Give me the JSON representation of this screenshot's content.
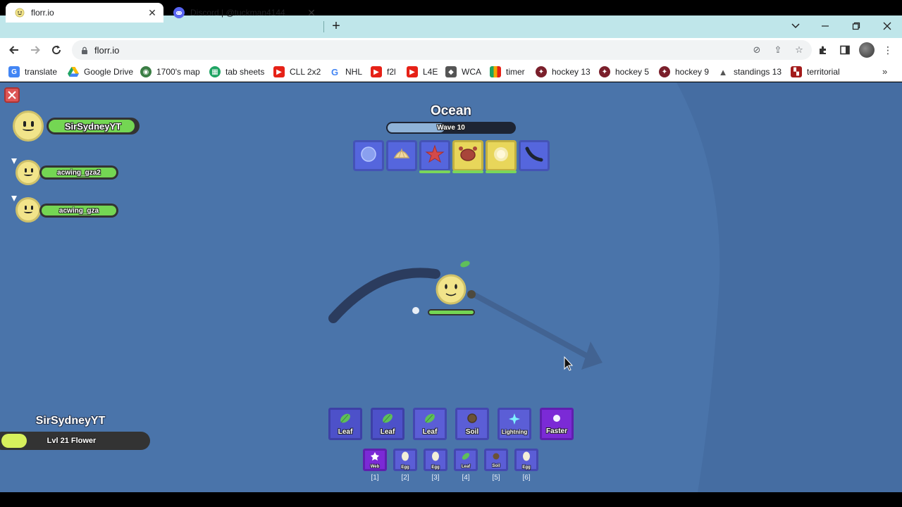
{
  "browser": {
    "tabs": [
      {
        "title": "florr.io",
        "icon": "florr-favicon",
        "active": true
      },
      {
        "title": "Discord | @tuckman4144",
        "icon": "discord-favicon",
        "active": false
      }
    ],
    "url": "florr.io",
    "bookmarks": [
      {
        "label": "translate",
        "icon": "google-translate-icon",
        "color": "#4285f4"
      },
      {
        "label": "Google Drive",
        "icon": "google-drive-icon",
        "color": "#fbbc04"
      },
      {
        "label": "1700's map",
        "icon": "map-icon",
        "color": "#3a7d44"
      },
      {
        "label": "tab sheets",
        "icon": "sheets-icon",
        "color": "#1fa463"
      },
      {
        "label": "CLL 2x2",
        "icon": "youtube-icon",
        "color": "#e62117"
      },
      {
        "label": "NHL",
        "icon": "google-icon",
        "color": "#4285f4"
      },
      {
        "label": "f2l",
        "icon": "youtube-icon",
        "color": "#e62117"
      },
      {
        "label": "L4E",
        "icon": "youtube-icon",
        "color": "#e62117"
      },
      {
        "label": "WCA",
        "icon": "wca-icon",
        "color": "#555555"
      },
      {
        "label": "timer",
        "icon": "timer-icon",
        "color": "#f2a900"
      },
      {
        "label": "hockey 13",
        "icon": "hockey-icon",
        "color": "#7a1f2b"
      },
      {
        "label": "hockey 5",
        "icon": "hockey-icon",
        "color": "#7a1f2b"
      },
      {
        "label": "hockey 9",
        "icon": "hockey-icon",
        "color": "#7a1f2b"
      },
      {
        "label": "standings 13",
        "icon": "standings-icon",
        "color": "#555555"
      },
      {
        "label": "territorial",
        "icon": "territorial-icon",
        "color": "#a31b1b"
      }
    ]
  },
  "game": {
    "biome": "Ocean",
    "wave_label": "Wave 10",
    "wave_progress": 0.45,
    "players": [
      {
        "name": "SirSydneyYT",
        "health": 0.97
      },
      {
        "name": "acwing_gza2",
        "health": 1.0
      },
      {
        "name": "acwing_gza",
        "health": 1.0
      }
    ],
    "mobs": [
      {
        "name": "bubble-icon",
        "color": "#5566dd",
        "highlighted": false,
        "health_bar": false
      },
      {
        "name": "shell-icon",
        "color": "#5566dd",
        "highlighted": false,
        "health_bar": false
      },
      {
        "name": "starfish-icon",
        "color": "#5566dd",
        "highlighted": false,
        "health_bar": true
      },
      {
        "name": "crab-icon",
        "color": "#e8d65a",
        "highlighted": true,
        "health_bar": true
      },
      {
        "name": "jellyfish-icon",
        "color": "#e8d65a",
        "highlighted": true,
        "health_bar": true
      },
      {
        "name": "leech-icon",
        "color": "#5566dd",
        "highlighted": false,
        "health_bar": false
      }
    ],
    "main_petals": [
      {
        "label": "Leaf",
        "icon": "leaf-icon",
        "color": "#5b5ed6"
      },
      {
        "label": "Leaf",
        "icon": "leaf-icon",
        "color": "#5b5ed6"
      },
      {
        "label": "Leaf",
        "icon": "leaf-icon",
        "color": "#5b5ed6"
      },
      {
        "label": "Soil",
        "icon": "soil-icon",
        "color": "#5b5ed6"
      },
      {
        "label": "Lightning",
        "icon": "lightning-icon",
        "color": "#5b5ed6"
      },
      {
        "label": "Faster",
        "icon": "faster-icon",
        "color": "#7b2ad6"
      }
    ],
    "secondary_petals": [
      {
        "label": "Web",
        "icon": "web-icon",
        "color": "#7b2ad6",
        "key": "[1]"
      },
      {
        "label": "Egg",
        "icon": "egg-icon",
        "color": "#5b5ed6",
        "key": "[2]"
      },
      {
        "label": "Egg",
        "icon": "egg-icon",
        "color": "#5b5ed6",
        "key": "[3]"
      },
      {
        "label": "Leaf",
        "icon": "leaf-icon",
        "color": "#5b5ed6",
        "key": "[4]"
      },
      {
        "label": "Soil",
        "icon": "soil-icon",
        "color": "#5b5ed6",
        "key": "[5]"
      },
      {
        "label": "Egg",
        "icon": "egg-icon",
        "color": "#5b5ed6",
        "key": "[6]"
      }
    ],
    "self": {
      "name": "SirSydneyYT",
      "level_label": "Lvl 21 Flower",
      "level_progress": 0.18
    }
  }
}
